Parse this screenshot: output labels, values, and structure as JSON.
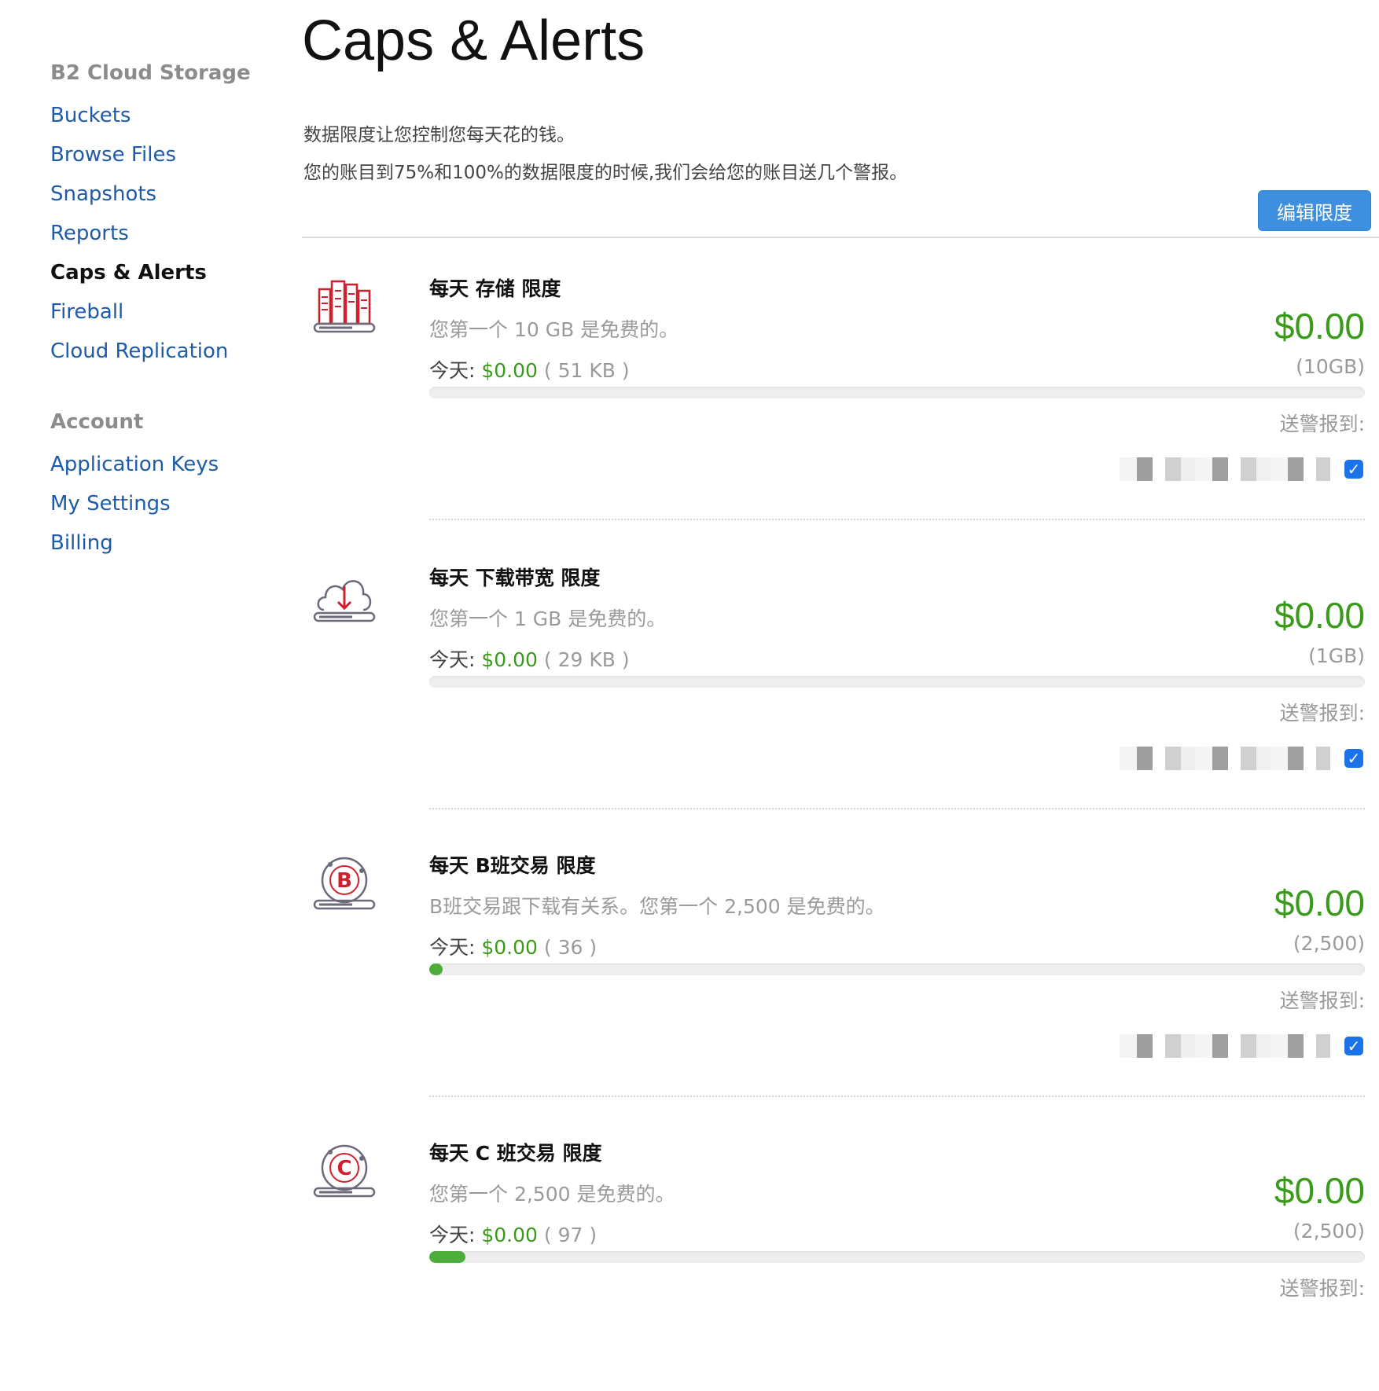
{
  "sidebar": {
    "section_storage": "B2 Cloud Storage",
    "links": [
      "Buckets",
      "Browse Files",
      "Snapshots",
      "Reports",
      "Caps & Alerts",
      "Fireball",
      "Cloud Replication"
    ],
    "section_account": "Account",
    "account_links": [
      "Application Keys",
      "My Settings",
      "Billing"
    ]
  },
  "page": {
    "title": "Caps & Alerts",
    "intro_line1": "数据限度让您控制您每天花的钱。",
    "intro_line2": "您的账目到75%和100%的数据限度的时候,我们会给您的账目送几个警报。",
    "edit_button": "编辑限度"
  },
  "caps": [
    {
      "icon": "storage-icon",
      "title": "每天 存储 限度",
      "description": "您第一个 10 GB 是免费的。",
      "today_label": "今天: ",
      "today_amount": "$0.00",
      "today_usage": " ( 51 KB )",
      "price": "$0.00",
      "cap": "(10GB)",
      "progress": 0.0,
      "alert_label": "送警报到:",
      "alert_email": "redacted",
      "alert_checked": true
    },
    {
      "icon": "cloud-download-icon",
      "title": "每天 下载带宽 限度",
      "description": "您第一个 1 GB 是免费的。",
      "today_label": "今天: ",
      "today_amount": "$0.00",
      "today_usage": " ( 29 KB )",
      "price": "$0.00",
      "cap": "(1GB)",
      "progress": 0.0,
      "alert_label": "送警报到:",
      "alert_email": "redacted",
      "alert_checked": true
    },
    {
      "icon": "class-b-transaction-icon",
      "icon_letter": "B",
      "title": "每天 B班交易 限度",
      "description": "B班交易跟下载有关系。您第一个 2,500 是免费的。",
      "today_label": "今天: ",
      "today_amount": "$0.00",
      "today_usage": " ( 36 )",
      "price": "$0.00",
      "cap": "(2,500)",
      "progress": 0.0144,
      "alert_label": "送警报到:",
      "alert_email": "redacted",
      "alert_checked": true
    },
    {
      "icon": "class-c-transaction-icon",
      "icon_letter": "C",
      "title": "每天 C 班交易 限度",
      "description": "您第一个 2,500 是免费的。",
      "today_label": "今天: ",
      "today_amount": "$0.00",
      "today_usage": " ( 97 )",
      "price": "$0.00",
      "cap": "(2,500)",
      "progress": 0.0388,
      "alert_label": "送警报到:"
    }
  ],
  "colors": {
    "link": "#1e5aa8",
    "money_green": "#3a9a1a",
    "button_blue": "#3f8fe0",
    "icon_red": "#d0202e"
  }
}
